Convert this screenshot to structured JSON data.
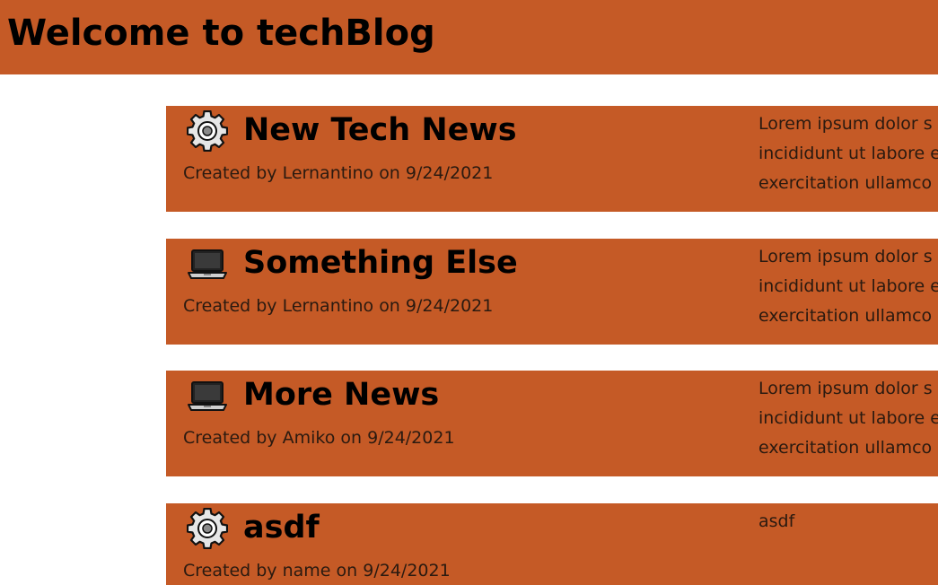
{
  "header": {
    "title": "Welcome to techBlog"
  },
  "colors": {
    "accent": "#c55a26",
    "background": "#ffffff",
    "text": "#000000"
  },
  "posts": [
    {
      "icon": "gear-icon",
      "title": "New Tech News",
      "created_prefix": "Created by",
      "author": "Lernantino",
      "on_word": "on",
      "date": "9/24/2021",
      "body_lines": [
        "Lorem ipsum dolor s",
        "incididunt ut labore e",
        "exercitation ullamco"
      ]
    },
    {
      "icon": "laptop-icon",
      "title": "Something Else",
      "created_prefix": "Created by",
      "author": "Lernantino",
      "on_word": "on",
      "date": "9/24/2021",
      "body_lines": [
        "Lorem ipsum dolor s",
        "incididunt ut labore e",
        "exercitation ullamco"
      ]
    },
    {
      "icon": "laptop-icon",
      "title": "More News",
      "created_prefix": "Created by",
      "author": "Amiko",
      "on_word": "on",
      "date": "9/24/2021",
      "body_lines": [
        "Lorem ipsum dolor s",
        "incididunt ut labore e",
        "exercitation ullamco"
      ]
    },
    {
      "icon": "gear-icon",
      "title": "asdf",
      "created_prefix": "Created by",
      "author": "name",
      "on_word": "on",
      "date": "9/24/2021",
      "body_lines": [
        "asdf"
      ]
    }
  ]
}
